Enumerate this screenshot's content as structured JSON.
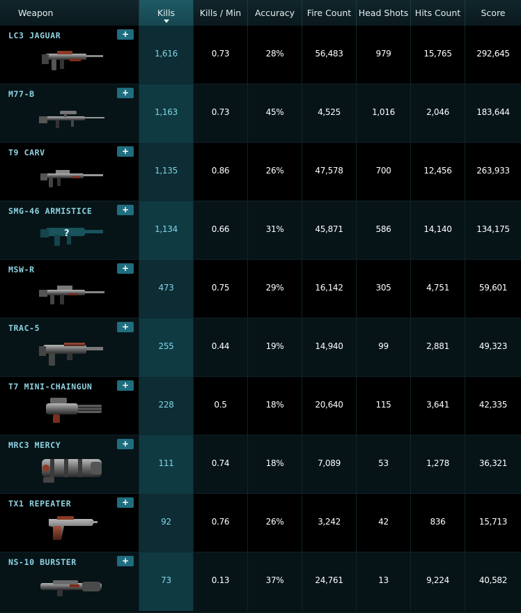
{
  "headers": {
    "weapon": "Weapon",
    "kills": "Kills",
    "kills_per_min": "Kills / Min",
    "accuracy": "Accuracy",
    "fire_count": "Fire Count",
    "head_shots": "Head Shots",
    "hits_count": "Hits Count",
    "score": "Score"
  },
  "sort_column": "kills",
  "plus_label": "+",
  "rows": [
    {
      "name": "LC3 JAGUAR",
      "icon": "rifle-icon",
      "kills": "1,616",
      "kpm": "0.73",
      "accuracy": "28%",
      "fire": "56,483",
      "head": "979",
      "hits": "15,765",
      "score": "292,645"
    },
    {
      "name": "M77-B",
      "icon": "sniper-rifle-icon",
      "kills": "1,163",
      "kpm": "0.73",
      "accuracy": "45%",
      "fire": "4,525",
      "head": "1,016",
      "hits": "2,046",
      "score": "183,644"
    },
    {
      "name": "T9 CARV",
      "icon": "carbine-icon",
      "kills": "1,135",
      "kpm": "0.86",
      "accuracy": "26%",
      "fire": "47,578",
      "head": "700",
      "hits": "12,456",
      "score": "263,933"
    },
    {
      "name": "SMG-46 ARMISTICE",
      "icon": "unknown-weapon-icon",
      "kills": "1,134",
      "kpm": "0.66",
      "accuracy": "31%",
      "fire": "45,871",
      "head": "586",
      "hits": "14,140",
      "score": "134,175"
    },
    {
      "name": "MSW-R",
      "icon": "machine-gun-icon",
      "kills": "473",
      "kpm": "0.75",
      "accuracy": "29%",
      "fire": "16,142",
      "head": "305",
      "hits": "4,751",
      "score": "59,601"
    },
    {
      "name": "TRAC-5",
      "icon": "heavy-rifle-icon",
      "kills": "255",
      "kpm": "0.44",
      "accuracy": "19%",
      "fire": "14,940",
      "head": "99",
      "hits": "2,881",
      "score": "49,323"
    },
    {
      "name": "T7 MINI-CHAINGUN",
      "icon": "chaingun-icon",
      "kills": "228",
      "kpm": "0.5",
      "accuracy": "18%",
      "fire": "20,640",
      "head": "115",
      "hits": "3,641",
      "score": "42,335"
    },
    {
      "name": "MRC3 MERCY",
      "icon": "rotary-cannon-icon",
      "kills": "111",
      "kpm": "0.74",
      "accuracy": "18%",
      "fire": "7,089",
      "head": "53",
      "hits": "1,278",
      "score": "36,321"
    },
    {
      "name": "TX1 REPEATER",
      "icon": "pistol-icon",
      "kills": "92",
      "kpm": "0.76",
      "accuracy": "26%",
      "fire": "3,242",
      "head": "42",
      "hits": "836",
      "score": "15,713"
    },
    {
      "name": "NS-10 BURSTER",
      "icon": "launcher-icon",
      "kills": "73",
      "kpm": "0.13",
      "accuracy": "37%",
      "fire": "24,761",
      "head": "13",
      "hits": "9,224",
      "score": "40,582"
    }
  ],
  "colors": {
    "accent": "#1f6d7e",
    "weapon_name": "#8fd3e2",
    "kills_text": "#7fd6ea",
    "header_sorted": "#1e5a64"
  }
}
